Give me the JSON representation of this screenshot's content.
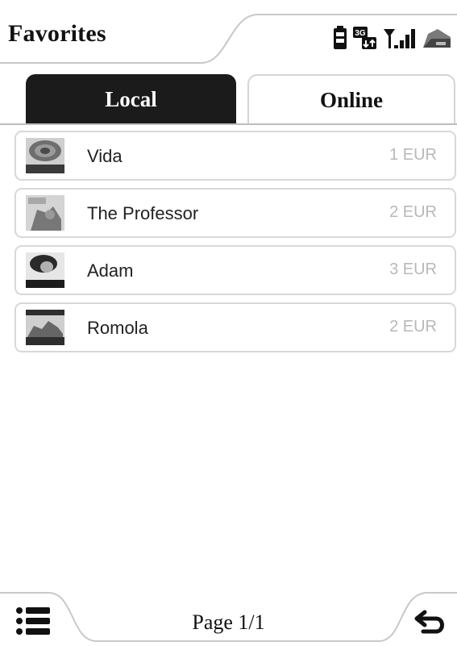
{
  "header": {
    "title": "Favorites",
    "status_icons": [
      "battery-icon",
      "3g-data-icon",
      "signal-strength-icon",
      "folder-icon"
    ]
  },
  "tabs": [
    {
      "label": "Local",
      "active": true
    },
    {
      "label": "Online",
      "active": false
    }
  ],
  "items": [
    {
      "title": "Vida",
      "price": "1 EUR",
      "thumb_icon": "album-cover-vida"
    },
    {
      "title": "The Professor",
      "price": "2 EUR",
      "thumb_icon": "album-cover-professor"
    },
    {
      "title": "Adam",
      "price": "3 EUR",
      "thumb_icon": "album-cover-adam"
    },
    {
      "title": "Romola",
      "price": "2 EUR",
      "thumb_icon": "album-cover-romola"
    }
  ],
  "footer": {
    "page_text": "Page 1/1",
    "left_icon": "menu-list-icon",
    "right_icon": "back-arrow-icon"
  },
  "colors": {
    "active_tab_bg": "#1b1b1b",
    "price_text": "#b8b8b8",
    "border": "#d8d8d8"
  }
}
